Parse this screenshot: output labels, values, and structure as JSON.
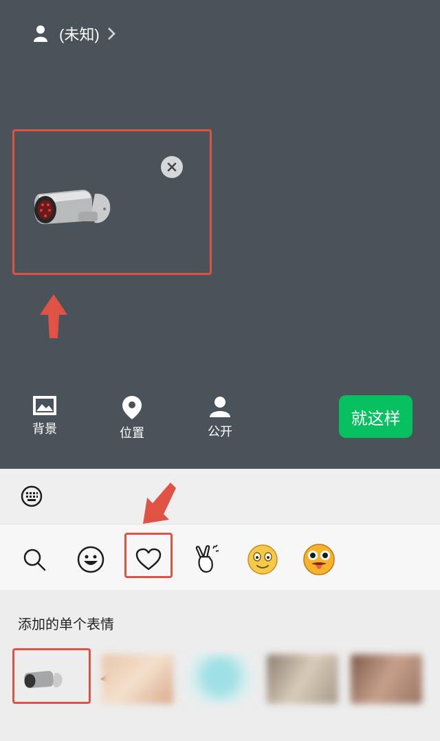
{
  "header": {
    "user_name": "(未知)"
  },
  "toolbar": {
    "background_label": "背景",
    "location_label": "位置",
    "public_label": "公开",
    "done_label": "就这样"
  },
  "emoji_panel": {
    "section_title": "添加的单个表情",
    "tabs": [
      "search",
      "emoji",
      "favorites",
      "peace-hand",
      "smiley",
      "tongue-face"
    ]
  },
  "colors": {
    "top_background": "#4b535a",
    "highlight_red": "#e05243",
    "primary_green": "#07c160"
  }
}
